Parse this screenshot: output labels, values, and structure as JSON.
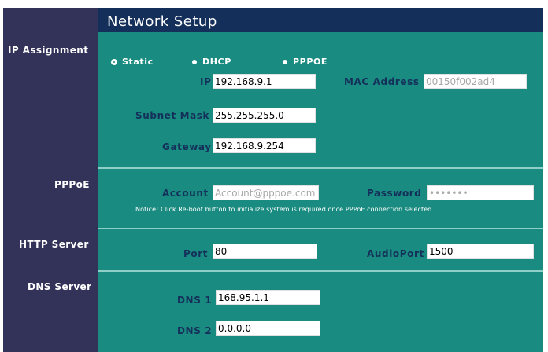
{
  "title": "Network Setup",
  "colors": {
    "sidebar": "#33335a",
    "content": "#1a8b80",
    "title_bar": "#14305a",
    "separator": "#8ecfc7",
    "label": "#14305a"
  },
  "sidebar": {
    "ip_assignment": "IP Assignment",
    "pppoe": "PPPoE",
    "http_server": "HTTP Server",
    "dns_server": "DNS Server"
  },
  "ip_assignment": {
    "modes": [
      {
        "label": "Static",
        "selected": true
      },
      {
        "label": "DHCP",
        "selected": false
      },
      {
        "label": "PPPOE",
        "selected": false
      }
    ],
    "ip": {
      "label": "IP",
      "value": "192.168.9.1"
    },
    "mac": {
      "label": "MAC Address",
      "value": "00150f002ad4"
    },
    "subnet": {
      "label": "Subnet Mask",
      "value": "255.255.255.0"
    },
    "gateway": {
      "label": "Gateway",
      "value": "192.168.9.254"
    }
  },
  "pppoe": {
    "account": {
      "label": "Account",
      "value": "Account@pppoe.com"
    },
    "password": {
      "label": "Password",
      "value": "•••••••"
    },
    "notice": "Notice! Click Re-boot button to initialize system is required once PPPoE connection selected"
  },
  "http_server": {
    "port": {
      "label": "Port",
      "value": "80"
    },
    "audio_port": {
      "label": "AudioPort",
      "value": "1500"
    }
  },
  "dns_server": {
    "dns1": {
      "label": "DNS 1",
      "value": "168.95.1.1"
    },
    "dns2": {
      "label": "DNS 2",
      "value": "0.0.0.0"
    }
  }
}
